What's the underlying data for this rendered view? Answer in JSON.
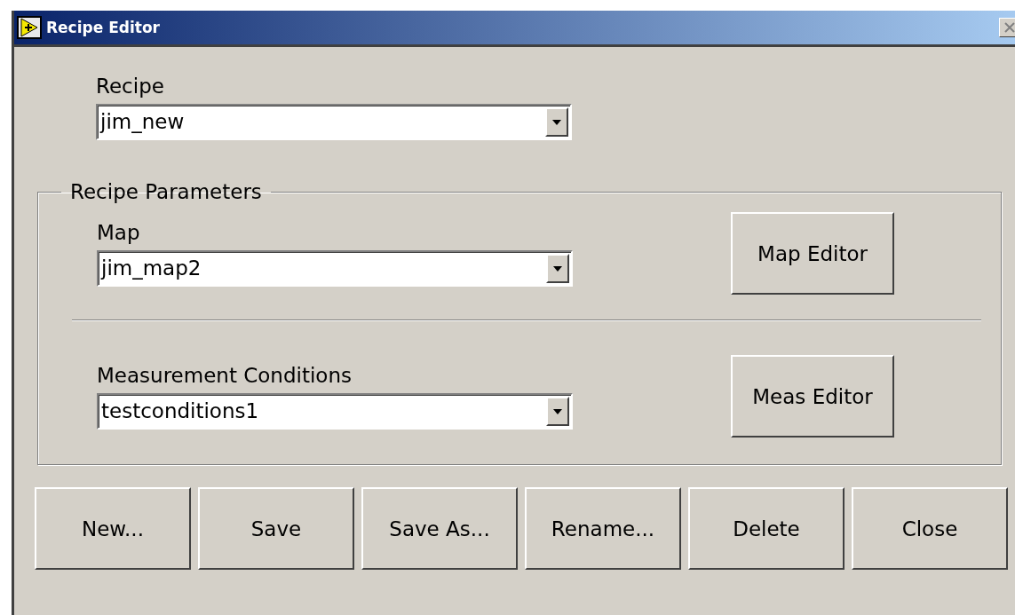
{
  "window": {
    "title": "Recipe Editor"
  },
  "recipe": {
    "label": "Recipe",
    "value": "jim_new"
  },
  "parameters": {
    "title": "Recipe Parameters",
    "sections": [
      {
        "label": "Map",
        "value": "jim_map2",
        "button": "Map Editor"
      },
      {
        "label": "Measurement Conditions",
        "value": "testconditions1",
        "button": "Meas Editor"
      }
    ]
  },
  "buttons": [
    "New...",
    "Save",
    "Save As...",
    "Rename...",
    "Delete",
    "Close"
  ]
}
